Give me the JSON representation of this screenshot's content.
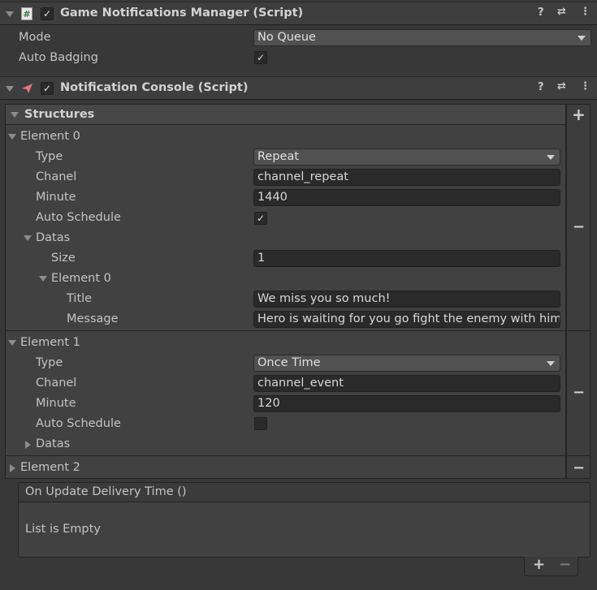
{
  "component1": {
    "title": "Game Notifications Manager (Script)",
    "icon": "script-hash-icon",
    "mode_label": "Mode",
    "mode_value": "No Queue",
    "auto_badging_label": "Auto Badging",
    "auto_badging_checked": "✓"
  },
  "component2": {
    "title": "Notification Console (Script)",
    "icon": "paper-plane-icon",
    "structures_label": "Structures",
    "add_symbol": "+",
    "elements": [
      {
        "label": "Element 0",
        "type_label": "Type",
        "type_value": "Repeat",
        "chanel_label": "Chanel",
        "chanel_value": "channel_repeat",
        "minute_label": "Minute",
        "minute_value": "1440",
        "auto_schedule_label": "Auto Schedule",
        "auto_schedule_checked": "✓",
        "datas_label": "Datas",
        "size_label": "Size",
        "size_value": "1",
        "inner_element_label": "Element 0",
        "title_label": "Title",
        "title_value": "We miss you so much!",
        "message_label": "Message",
        "message_value": "Hero is waiting for you go fight the enemy with him."
      },
      {
        "label": "Element 1",
        "type_label": "Type",
        "type_value": "Once Time",
        "chanel_label": "Chanel",
        "chanel_value": "channel_event",
        "minute_label": "Minute",
        "minute_value": "120",
        "auto_schedule_label": "Auto Schedule",
        "auto_schedule_checked": "",
        "datas_label": "Datas"
      },
      {
        "label": "Element 2"
      }
    ],
    "minus_symbol": "−"
  },
  "event": {
    "title": "On Update Delivery Time ()",
    "empty_text": "List is Empty",
    "add_symbol": "+",
    "remove_symbol": "−"
  }
}
